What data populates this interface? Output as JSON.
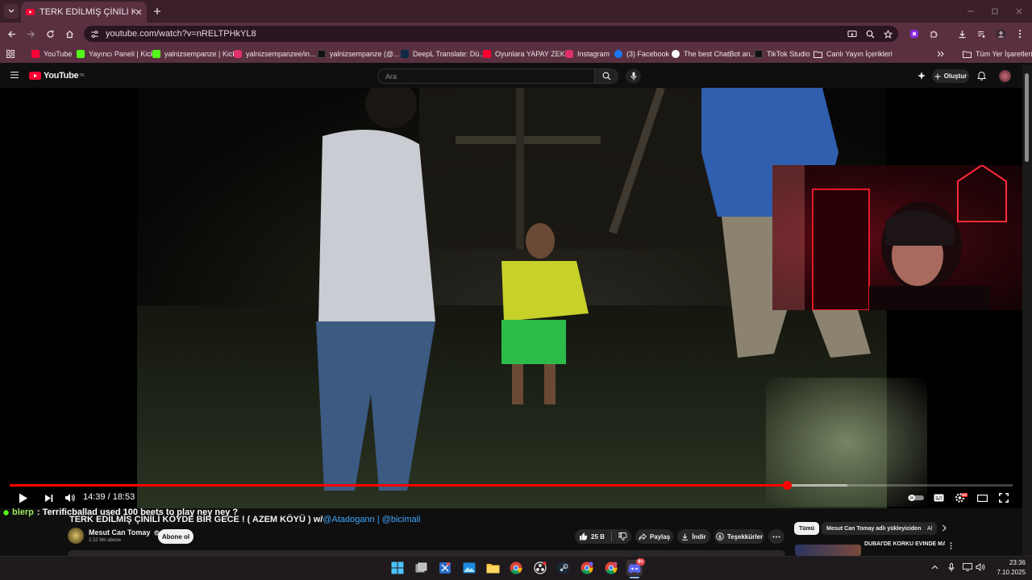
{
  "browser": {
    "active_tab_title": "TERK EDİLMİŞ ÇİNİLİ KÖYDE BİR",
    "url": "youtube.com/watch?v=nRELTPHkYL8",
    "bookmarks": [
      {
        "label": "YouTube",
        "icon": "youtube-icon",
        "color": "#ff0033"
      },
      {
        "label": "Yayıncı Paneli | Kick",
        "icon": "kick-icon",
        "color": "#53fc18"
      },
      {
        "label": "yalnizsempanze | Kick",
        "icon": "kick-icon",
        "color": "#53fc18"
      },
      {
        "label": "yalnizsempanzee/in...",
        "icon": "instagram-icon",
        "color": "#e1306c"
      },
      {
        "label": "yalnizsempanze (@...",
        "icon": "tiktok-icon",
        "color": "#111111"
      },
      {
        "label": "DeepL Translate: Dü...",
        "icon": "deepl-icon",
        "color": "#0f2b46"
      },
      {
        "label": "Oyunlara YAPAY ZEK...",
        "icon": "youtube-icon",
        "color": "#ff0033"
      },
      {
        "label": "Instagram",
        "icon": "instagram-icon",
        "color": "#e1306c"
      },
      {
        "label": "(3) Facebook",
        "icon": "facebook-icon",
        "color": "#1877f2"
      },
      {
        "label": "The best ChatBot an...",
        "icon": "chatgpt-icon",
        "color": "#ffffff"
      },
      {
        "label": "TikTok Studio",
        "icon": "tiktok-icon",
        "color": "#111111"
      },
      {
        "label": "Canlı Yayın İçerikleri",
        "icon": "folder-icon",
        "color": "#5a3041"
      }
    ],
    "all_bookmarks_label": "Tüm Yer İşaretleri"
  },
  "youtube": {
    "logo_text": "YouTube",
    "logo_region": "TR",
    "search_placeholder": "Ara",
    "create_label": "Oluştur",
    "player": {
      "current_time": "14:39",
      "duration": "18:53",
      "time_display": "14:39 / 18:53",
      "played_fraction": 0.775,
      "buffered_fraction": 0.835
    },
    "chat": {
      "user": "blerp",
      "message": ": Terrificballad used 100 beets to play ney ney ?"
    },
    "video": {
      "title_prefix": "TERK EDİLMİŞ ÇİNİLİ KÖYDE BİR GECE ! ( AZEM KÖYÜ ) w/",
      "mention1": "@Atadogann",
      "separator": " | ",
      "mention2": "@bicimali"
    },
    "channel": {
      "name": "Mesut Can Tomay",
      "subscribers": "2,32 Mn abone",
      "subscribe_label": "Abone ol"
    },
    "actions": {
      "likes": "25 B",
      "share": "Paylaş",
      "download": "İndir",
      "thanks": "Teşekkürler"
    },
    "chips": [
      {
        "label": "Tümü",
        "active": true
      },
      {
        "label": "Mesut Can Tomay adlı yükleyiciden",
        "active": false
      },
      {
        "label": "Al",
        "active": false
      }
    ],
    "recommended": {
      "title": "DUBAİ'DE KORKU EVİNDE MAHSUR KALDIK ! w/@bicimali"
    }
  },
  "taskbar": {
    "time": "23:36",
    "date": "7.10.2025",
    "discord_badge": "9+"
  }
}
